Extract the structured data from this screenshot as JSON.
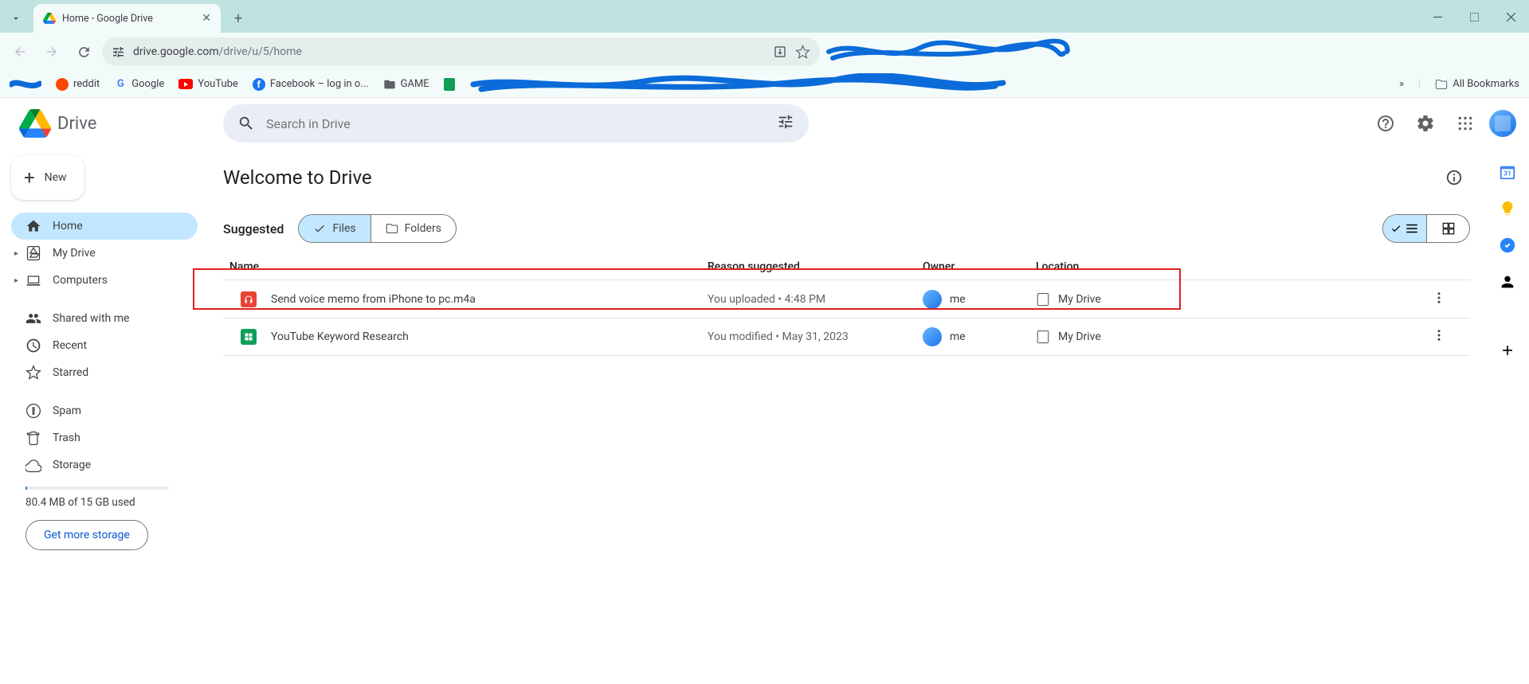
{
  "browser": {
    "tab_title": "Home - Google Drive",
    "url_host": "drive.google.com",
    "url_path": "/drive/u/5/home"
  },
  "bookmarks": {
    "items": [
      "reddit",
      "Google",
      "YouTube",
      "Facebook – log in o...",
      "GAME"
    ],
    "all": "All Bookmarks"
  },
  "header": {
    "app_name": "Drive",
    "search_placeholder": "Search in Drive"
  },
  "sidebar": {
    "new_label": "New",
    "items": {
      "home": "Home",
      "mydrive": "My Drive",
      "computers": "Computers",
      "shared": "Shared with me",
      "recent": "Recent",
      "starred": "Starred",
      "spam": "Spam",
      "trash": "Trash",
      "storage": "Storage"
    },
    "storage_used": "80.4 MB of 15 GB used",
    "get_storage": "Get more storage"
  },
  "main": {
    "welcome": "Welcome to Drive",
    "suggested_label": "Suggested",
    "chip_files": "Files",
    "chip_folders": "Folders",
    "columns": {
      "name": "Name",
      "reason": "Reason suggested",
      "owner": "Owner",
      "location": "Location"
    },
    "rows": [
      {
        "name": "Send voice memo from iPhone to pc.m4a",
        "reason": "You uploaded • 4:48 PM",
        "owner": "me",
        "location": "My Drive",
        "icon": "audio"
      },
      {
        "name": "YouTube Keyword Research",
        "reason": "You modified • May 31, 2023",
        "owner": "me",
        "location": "My Drive",
        "icon": "sheets"
      }
    ]
  }
}
